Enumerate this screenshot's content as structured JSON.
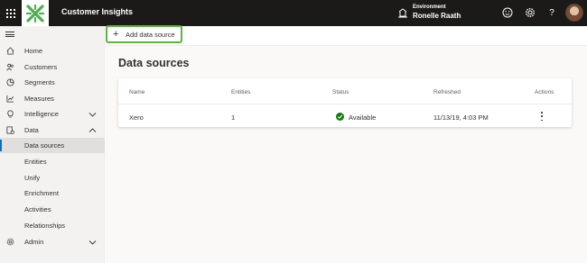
{
  "header": {
    "app_title": "Customer Insights",
    "environment_label": "Environment",
    "environment_name": "Ronelle Raath",
    "icons": [
      "waffle-icon",
      "customer-insights-logo",
      "environment-icon",
      "smiley-icon",
      "gear-icon",
      "help-icon",
      "avatar"
    ],
    "help_glyph": "?"
  },
  "sidebar": {
    "items": [
      {
        "label": "Home",
        "icon": "home-icon"
      },
      {
        "label": "Customers",
        "icon": "customers-icon"
      },
      {
        "label": "Segments",
        "icon": "segments-icon"
      },
      {
        "label": "Measures",
        "icon": "measures-icon"
      },
      {
        "label": "Intelligence",
        "icon": "lightbulb-icon",
        "expandable": true,
        "expanded": false
      },
      {
        "label": "Data",
        "icon": "data-icon",
        "expandable": true,
        "expanded": true
      },
      {
        "label": "Data sources",
        "selected": true
      },
      {
        "label": "Entities"
      },
      {
        "label": "Unify"
      },
      {
        "label": "Enrichment"
      },
      {
        "label": "Activities"
      },
      {
        "label": "Relationships"
      },
      {
        "label": "Admin",
        "icon": "gear-icon",
        "expandable": true,
        "expanded": false
      }
    ]
  },
  "toolbar": {
    "add_label": "Add data source"
  },
  "main": {
    "title": "Data sources",
    "table": {
      "headers": [
        "Name",
        "Entities",
        "Status",
        "Refreshed",
        "Actions"
      ],
      "rows": [
        {
          "name": "Xero",
          "entities": "1",
          "status": "Available",
          "refreshed": "11/13/19, 4:03 PM"
        }
      ]
    }
  },
  "colors": {
    "topbar": "#1b1a19",
    "accent": "#106ebe",
    "highlight": "#5db33f",
    "status_ok": "#107c10"
  }
}
